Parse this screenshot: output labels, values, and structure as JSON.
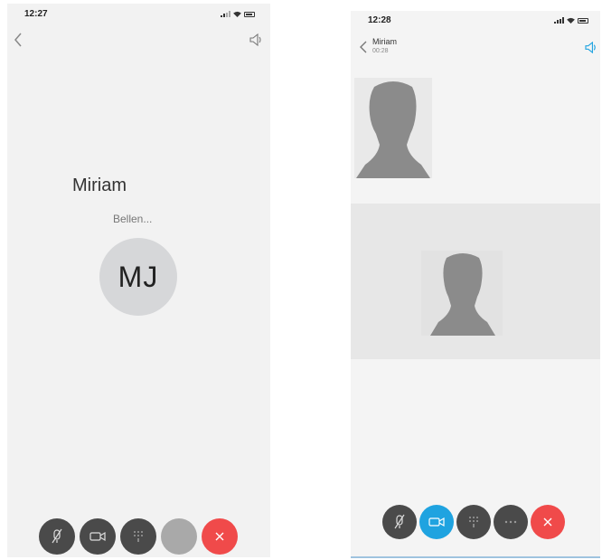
{
  "calling_screen": {
    "status_time": "12:27",
    "contact_name": "Miriam",
    "call_status": "Bellen...",
    "avatar_initials": "MJ",
    "controls": [
      {
        "icon": "mute-mic-icon",
        "color": "#4a4a4a"
      },
      {
        "icon": "video-camera-icon",
        "color": "#4a4a4a"
      },
      {
        "icon": "keypad-icon",
        "color": "#4a4a4a"
      },
      {
        "icon": "blank",
        "color": "#a9a9a9"
      },
      {
        "icon": "end-call-x-icon",
        "color": "#f04a4a"
      }
    ]
  },
  "video_call_screen": {
    "status_time": "12:28",
    "contact_name": "Miriam",
    "call_duration": "00:28",
    "controls": [
      {
        "icon": "mute-mic-icon",
        "color": "#4a4a4a"
      },
      {
        "icon": "video-camera-icon",
        "color": "#1fa3e0"
      },
      {
        "icon": "keypad-icon",
        "color": "#4a4a4a"
      },
      {
        "icon": "more-icon",
        "color": "#4a4a4a"
      },
      {
        "icon": "end-call-x-icon",
        "color": "#f04a4a"
      }
    ]
  },
  "colors": {
    "accent_blue": "#1fa3e0",
    "end_call_red": "#f04a4a",
    "control_gray": "#4a4a4a"
  }
}
